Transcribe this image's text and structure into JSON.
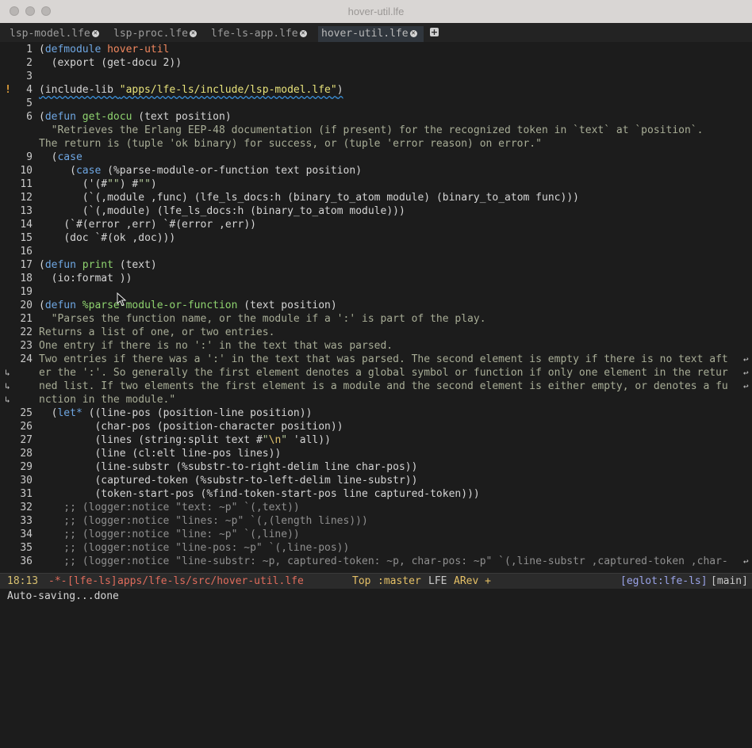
{
  "window": {
    "title": "hover-util.lfe"
  },
  "tabs": [
    {
      "label": "lsp-model.lfe",
      "active": false
    },
    {
      "label": "lsp-proc.lfe",
      "active": false
    },
    {
      "label": "lfe-ls-app.lfe",
      "active": false
    },
    {
      "label": "hover-util.lfe",
      "active": true
    }
  ],
  "lines": [
    {
      "n": "1",
      "seg": [
        [
          "p",
          "("
        ],
        [
          "kw",
          "defmodule"
        ],
        [
          "t",
          " "
        ],
        [
          "mod",
          "hover-util"
        ]
      ]
    },
    {
      "n": "2",
      "seg": [
        [
          "t",
          "  "
        ],
        [
          "p",
          "("
        ],
        [
          "t",
          "export "
        ],
        [
          "p",
          "("
        ],
        [
          "t",
          "get-docu 2"
        ],
        [
          "p",
          "))"
        ]
      ]
    },
    {
      "n": "3",
      "seg": []
    },
    {
      "n": "4",
      "fringe": "!",
      "seg": [
        [
          "sq",
          "(include-lib "
        ],
        [
          "strlink",
          "\"apps/lfe-ls/include/lsp-model.lfe\""
        ],
        [
          "sq",
          ")"
        ]
      ]
    },
    {
      "n": "5",
      "seg": []
    },
    {
      "n": "6",
      "seg": [
        [
          "p",
          "("
        ],
        [
          "kw",
          "defun"
        ],
        [
          "t",
          " "
        ],
        [
          "fn",
          "get-docu"
        ],
        [
          "t",
          " "
        ],
        [
          "p",
          "("
        ],
        [
          "t",
          "text position"
        ],
        [
          "p",
          ")"
        ]
      ]
    },
    {
      "n": "",
      "seg": [
        [
          "doc",
          "  \"Retrieves the Erlang EEP-48 documentation (if present) for the recognized token in `text` at `position`."
        ]
      ]
    },
    {
      "n": "",
      "seg": [
        [
          "doc",
          "The return is (tuple 'ok binary) for success, or (tuple 'error reason) on error.\""
        ]
      ]
    },
    {
      "n": "9",
      "seg": [
        [
          "t",
          "  "
        ],
        [
          "p",
          "("
        ],
        [
          "kw",
          "case"
        ]
      ]
    },
    {
      "n": "10",
      "seg": [
        [
          "t",
          "     "
        ],
        [
          "p",
          "("
        ],
        [
          "kw",
          "case"
        ],
        [
          "t",
          " "
        ],
        [
          "p",
          "("
        ],
        [
          "t",
          "%parse-module-or-function text position"
        ],
        [
          "p",
          ")"
        ]
      ]
    },
    {
      "n": "11",
      "seg": [
        [
          "t",
          "       "
        ],
        [
          "p",
          "('(#"
        ],
        [
          "str",
          "\"\""
        ],
        [
          "p",
          ")"
        ],
        [
          "t",
          " #"
        ],
        [
          "str",
          "\"\""
        ],
        [
          "p",
          ")"
        ]
      ]
    },
    {
      "n": "12",
      "seg": [
        [
          "t",
          "       "
        ],
        [
          "p",
          "(`(,"
        ],
        [
          "t",
          "module ,func"
        ],
        [
          "p",
          ")"
        ],
        [
          "t",
          " "
        ],
        [
          "p",
          "("
        ],
        [
          "t",
          "lfe_ls_docs:h "
        ],
        [
          "p",
          "("
        ],
        [
          "t",
          "binary_to_atom module"
        ],
        [
          "p",
          ")"
        ],
        [
          "t",
          " "
        ],
        [
          "p",
          "("
        ],
        [
          "t",
          "binary_to_atom func"
        ],
        [
          "p",
          ")))"
        ]
      ]
    },
    {
      "n": "13",
      "seg": [
        [
          "t",
          "       "
        ],
        [
          "p",
          "(`(,"
        ],
        [
          "t",
          "module"
        ],
        [
          "p",
          ")"
        ],
        [
          "t",
          " "
        ],
        [
          "p",
          "("
        ],
        [
          "t",
          "lfe_ls_docs:h "
        ],
        [
          "p",
          "("
        ],
        [
          "t",
          "binary_to_atom module"
        ],
        [
          "p",
          ")))"
        ]
      ]
    },
    {
      "n": "14",
      "seg": [
        [
          "t",
          "    "
        ],
        [
          "p",
          "(`#("
        ],
        [
          "t",
          "error ,err"
        ],
        [
          "p",
          ")"
        ],
        [
          "t",
          " `#"
        ],
        [
          "p",
          "("
        ],
        [
          "t",
          "error ,err"
        ],
        [
          "p",
          "))"
        ]
      ]
    },
    {
      "n": "15",
      "seg": [
        [
          "t",
          "    "
        ],
        [
          "p",
          "("
        ],
        [
          "t",
          "doc `#"
        ],
        [
          "p",
          "("
        ],
        [
          "t",
          "ok ,doc"
        ],
        [
          "p",
          ")))"
        ]
      ]
    },
    {
      "n": "16",
      "seg": []
    },
    {
      "n": "17",
      "seg": [
        [
          "p",
          "("
        ],
        [
          "kw",
          "defun"
        ],
        [
          "t",
          " "
        ],
        [
          "fn",
          "print"
        ],
        [
          "t",
          " "
        ],
        [
          "p",
          "("
        ],
        [
          "t",
          "text"
        ],
        [
          "p",
          ")"
        ]
      ]
    },
    {
      "n": "18",
      "seg": [
        [
          "t",
          "  "
        ],
        [
          "p",
          "("
        ],
        [
          "t",
          "io:format "
        ],
        [
          "p",
          "))"
        ]
      ]
    },
    {
      "n": "19",
      "seg": []
    },
    {
      "n": "20",
      "seg": [
        [
          "p",
          "("
        ],
        [
          "kw",
          "defun"
        ],
        [
          "t",
          " "
        ],
        [
          "fn",
          "%parse-module-or-function"
        ],
        [
          "t",
          " "
        ],
        [
          "p",
          "("
        ],
        [
          "t",
          "text position"
        ],
        [
          "p",
          ")"
        ]
      ]
    },
    {
      "n": "21",
      "seg": [
        [
          "doc",
          "  \"Parses the function name, or the module if a ':' is part of the play."
        ]
      ]
    },
    {
      "n": "22",
      "seg": [
        [
          "doc",
          "Returns a list of one, or two entries."
        ]
      ]
    },
    {
      "n": "23",
      "seg": [
        [
          "doc",
          "One entry if there is no ':' in the text that was parsed."
        ]
      ]
    },
    {
      "n": "24",
      "seg": [
        [
          "doc",
          "Two entries if there was a ':' in the text that was parsed. The second element is empty if there is no text aft"
        ]
      ],
      "cont": true
    },
    {
      "n": "",
      "wrap": true,
      "seg": [
        [
          "doc",
          "er the ':'. So generally the first element denotes a global symbol or function if only one element in the retur"
        ]
      ],
      "cont": true
    },
    {
      "n": "",
      "wrap": true,
      "seg": [
        [
          "doc",
          "ned list. If two elements the first element is a module and the second element is either empty, or denotes a fu"
        ]
      ],
      "cont": true
    },
    {
      "n": "",
      "wrap": true,
      "seg": [
        [
          "doc",
          "nction in the module.\""
        ]
      ]
    },
    {
      "n": "25",
      "seg": [
        [
          "t",
          "  "
        ],
        [
          "p",
          "("
        ],
        [
          "kw",
          "let*"
        ],
        [
          "t",
          " "
        ],
        [
          "p",
          "(("
        ],
        [
          "t",
          "line-pos "
        ],
        [
          "p",
          "("
        ],
        [
          "t",
          "position-line position"
        ],
        [
          "p",
          "))"
        ]
      ]
    },
    {
      "n": "26",
      "seg": [
        [
          "t",
          "         "
        ],
        [
          "p",
          "("
        ],
        [
          "t",
          "char-pos "
        ],
        [
          "p",
          "("
        ],
        [
          "t",
          "position-character position"
        ],
        [
          "p",
          "))"
        ]
      ]
    },
    {
      "n": "27",
      "seg": [
        [
          "t",
          "         "
        ],
        [
          "p",
          "("
        ],
        [
          "t",
          "lines "
        ],
        [
          "p",
          "("
        ],
        [
          "t",
          "string:split text #"
        ],
        [
          "str",
          "\""
        ],
        [
          "esc",
          "\\n"
        ],
        [
          "str",
          "\""
        ],
        [
          "t",
          " 'all"
        ],
        [
          "p",
          "))"
        ]
      ]
    },
    {
      "n": "28",
      "seg": [
        [
          "t",
          "         "
        ],
        [
          "p",
          "("
        ],
        [
          "t",
          "line "
        ],
        [
          "p",
          "("
        ],
        [
          "t",
          "cl:elt line-pos lines"
        ],
        [
          "p",
          "))"
        ]
      ]
    },
    {
      "n": "29",
      "seg": [
        [
          "t",
          "         "
        ],
        [
          "p",
          "("
        ],
        [
          "t",
          "line-substr "
        ],
        [
          "p",
          "("
        ],
        [
          "t",
          "%substr-to-right-delim line char-pos"
        ],
        [
          "p",
          "))"
        ]
      ]
    },
    {
      "n": "30",
      "seg": [
        [
          "t",
          "         "
        ],
        [
          "p",
          "("
        ],
        [
          "t",
          "captured-token "
        ],
        [
          "p",
          "("
        ],
        [
          "t",
          "%substr-to-left-delim line-substr"
        ],
        [
          "p",
          "))"
        ]
      ]
    },
    {
      "n": "31",
      "seg": [
        [
          "t",
          "         "
        ],
        [
          "p",
          "("
        ],
        [
          "t",
          "token-start-pos "
        ],
        [
          "p",
          "("
        ],
        [
          "t",
          "%find-token-start-pos line captured-token"
        ],
        [
          "p",
          ")))"
        ]
      ]
    },
    {
      "n": "32",
      "seg": [
        [
          "cmt",
          "    ;; (logger:notice \"text: ~p\" `(,text))"
        ]
      ]
    },
    {
      "n": "33",
      "seg": [
        [
          "cmt",
          "    ;; (logger:notice \"lines: ~p\" `(,(length lines)))"
        ]
      ]
    },
    {
      "n": "34",
      "seg": [
        [
          "cmt",
          "    ;; (logger:notice \"line: ~p\" `(,line))"
        ]
      ]
    },
    {
      "n": "35",
      "seg": [
        [
          "cmt",
          "    ;; (logger:notice \"line-pos: ~p\" `(,line-pos))"
        ]
      ]
    },
    {
      "n": "36",
      "seg": [
        [
          "cmt",
          "    ;; (logger:notice \"line-substr: ~p, captured-token: ~p, char-pos: ~p\" `(,line-substr ,captured-token ,char-"
        ]
      ],
      "cont": true
    }
  ],
  "modeline": {
    "position": "18:13",
    "state": "-*-",
    "project": "[lfe-ls]",
    "path": "apps/lfe-ls/src/hover-util.lfe",
    "scroll": "Top",
    "branch": ":master",
    "mode": "LFE",
    "minor": "ARev +",
    "eglot": "[eglot:lfe-ls]",
    "extra": "[main]"
  },
  "echo": "Auto-saving...done",
  "colors": {
    "background": "#1c1c1c",
    "keyword": "#6fa7e3",
    "function": "#8fd36f",
    "module": "#f0875e",
    "warning": "#e5a23a"
  },
  "icons": {
    "close": "close-icon",
    "add": "add-tab-icon",
    "pointer": "mouse-pointer-icon"
  }
}
